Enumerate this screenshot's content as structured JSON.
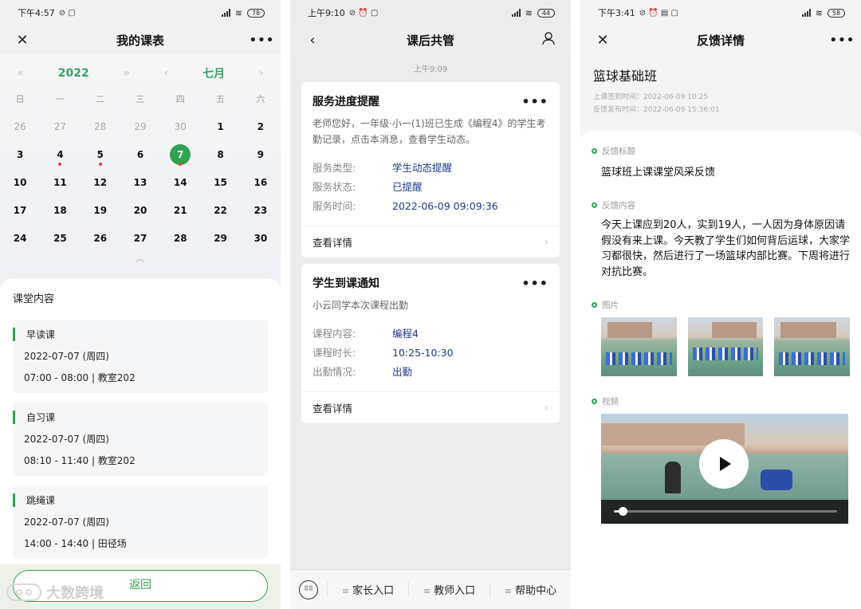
{
  "phone1": {
    "status": {
      "time": "下午4:57",
      "battery": "78"
    },
    "nav": {
      "title": "我的课表",
      "close_icon": "✕",
      "more_icon": "•••"
    },
    "calendar": {
      "year": "2022",
      "month": "七月",
      "weekdays": [
        "日",
        "一",
        "二",
        "三",
        "四",
        "五",
        "六"
      ],
      "rows": [
        [
          "26",
          "27",
          "28",
          "29",
          "30",
          "1",
          "2"
        ],
        [
          "3",
          "4",
          "5",
          "6",
          "7",
          "8",
          "9"
        ],
        [
          "10",
          "11",
          "12",
          "13",
          "14",
          "15",
          "16"
        ],
        [
          "17",
          "18",
          "19",
          "20",
          "21",
          "22",
          "23"
        ],
        [
          "24",
          "25",
          "26",
          "27",
          "28",
          "29",
          "30"
        ]
      ],
      "selected": "7",
      "dot_days": [
        "4",
        "5",
        "7"
      ]
    },
    "classes": {
      "title": "课堂内容",
      "items": [
        {
          "name": "早读课",
          "date": "2022-07-07 (周四)",
          "time": "07:00 - 08:00 | 教室202"
        },
        {
          "name": "自习课",
          "date": "2022-07-07 (周四)",
          "time": "08:10 - 11:40 | 教室202"
        },
        {
          "name": "跳绳课",
          "date": "2022-07-07 (周四)",
          "time": "14:00 - 14:40 | 田径场"
        }
      ]
    },
    "back_label": "返回",
    "watermark": "大数跨境"
  },
  "phone2": {
    "status": {
      "time": "上午9:10",
      "battery": "44"
    },
    "nav": {
      "title": "课后共管"
    },
    "chat_time": "上午9:09",
    "cards": [
      {
        "title": "服务进度提醒",
        "desc": "老师您好，一年级·小一(1)班已生成《编程4》的学生考勤记录，点击本消息，查看学生动态。",
        "rows": [
          {
            "k": "服务类型:",
            "v": "学生动态提醒"
          },
          {
            "k": "服务状态:",
            "v": "已提醒"
          },
          {
            "k": "服务时间:",
            "v": "2022-06-09 09:09:36"
          }
        ],
        "link": "查看详情"
      },
      {
        "title": "学生到课通知",
        "desc": "小云同学本次课程出勤",
        "rows": [
          {
            "k": "课程内容:",
            "v": "编程4"
          },
          {
            "k": "课程时长:",
            "v": "10:25-10:30"
          },
          {
            "k": "出勤情况:",
            "v": "出勤"
          }
        ],
        "link": "查看详情"
      }
    ],
    "tabs": [
      "家长入口",
      "教师入口",
      "帮助中心"
    ]
  },
  "phone3": {
    "status": {
      "time": "下午3:41",
      "battery": "58"
    },
    "nav": {
      "title": "反馈详情"
    },
    "course": "篮球基础班",
    "signin": "上课签到时间：2022-06-09    10:25",
    "published": "反馈发布时间：2022-06-09 15:36:01",
    "labels": {
      "title": "反馈标题",
      "content": "反馈内容",
      "images": "图片",
      "video": "视频"
    },
    "fb_title": "篮球班上课课堂风采反馈",
    "fb_content": "今天上课应到20人，实到19人，一人因为身体原因请假没有来上课。今天教了学生们如何背后运球，大家学习都很快，然后进行了一场篮球内部比赛。下周将进行对抗比赛。",
    "video_progress": 0.04
  }
}
